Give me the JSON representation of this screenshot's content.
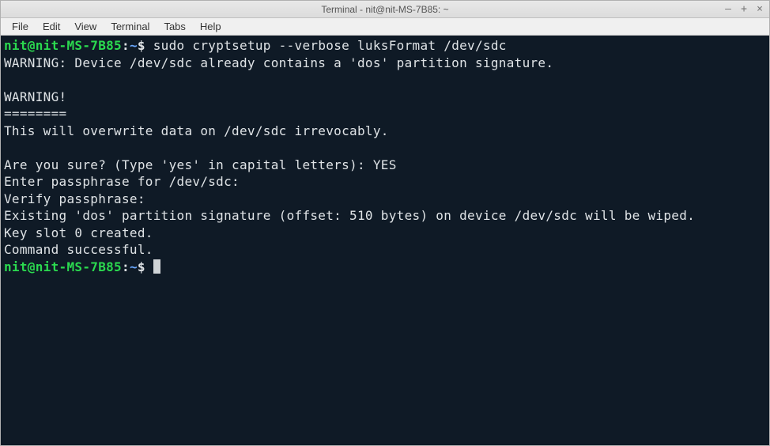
{
  "window": {
    "title": "Terminal - nit@nit-MS-7B85: ~"
  },
  "menu": {
    "file": "File",
    "edit": "Edit",
    "view": "View",
    "terminal": "Terminal",
    "tabs": "Tabs",
    "help": "Help"
  },
  "buttons": {
    "minimize": "–",
    "maximize": "+",
    "close": "×"
  },
  "prompt": {
    "user_host": "nit@nit-MS-7B85",
    "colon": ":",
    "path": "~",
    "sigil": "$ "
  },
  "session": {
    "cmd1": "sudo cryptsetup --verbose luksFormat /dev/sdc",
    "out1": "WARNING: Device /dev/sdc already contains a 'dos' partition signature.",
    "blank": "",
    "out2": "WARNING!",
    "out3": "========",
    "out4": "This will overwrite data on /dev/sdc irrevocably.",
    "out5": "Are you sure? (Type 'yes' in capital letters): YES",
    "out6": "Enter passphrase for /dev/sdc: ",
    "out7": "Verify passphrase: ",
    "out8": "Existing 'dos' partition signature (offset: 510 bytes) on device /dev/sdc will be wiped.",
    "out9": "Key slot 0 created.",
    "out10": "Command successful."
  }
}
